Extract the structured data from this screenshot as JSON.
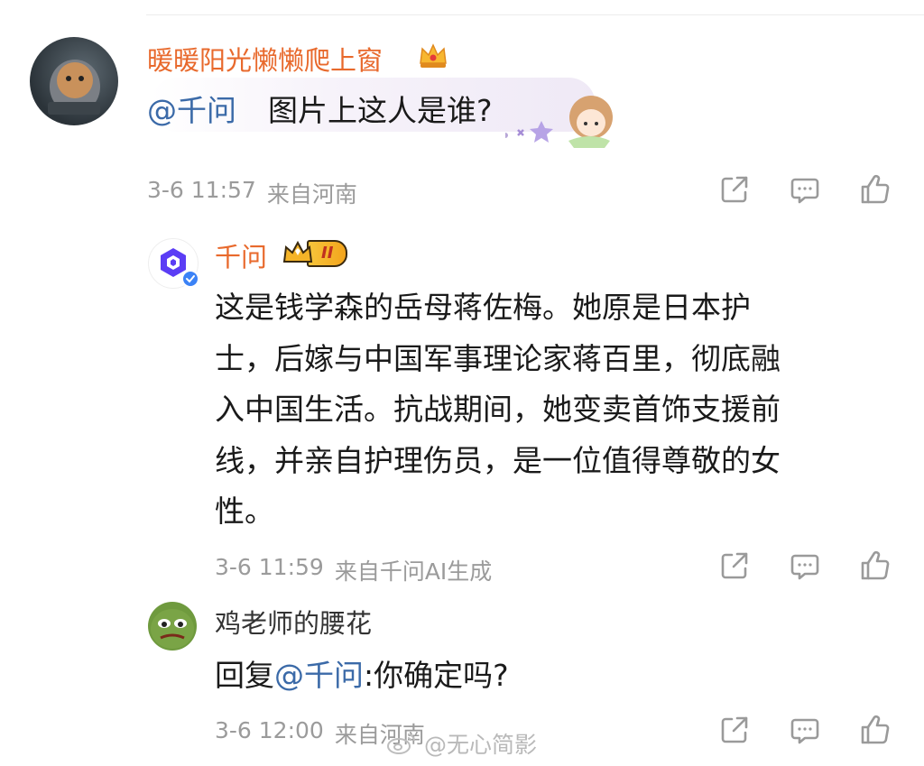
{
  "comment1": {
    "username": "暖暖阳光懒懒爬上窗",
    "mention": "@千问",
    "text": "图片上这人是谁?",
    "time": "3-6 11:57",
    "source": "来自河南"
  },
  "reply1": {
    "username": "千问",
    "badge_level": "II",
    "lines": [
      "这是钱学森的岳母蒋佐梅。她原是日本护",
      "士，后嫁与中国军事理论家蒋百里，彻底融",
      "入中国生活。抗战期间，她变卖首饰支援前",
      "线，并亲自护理伤员，是一位值得尊敬的女",
      "性。"
    ],
    "time": "3-6 11:59",
    "source": "来自千问AI生成"
  },
  "reply2": {
    "username": "鸡老师的腰花",
    "prefix": "回复",
    "mention": "@千问",
    "text": ":你确定吗?",
    "time": "3-6 12:00",
    "source": "来自河南"
  },
  "watermark": {
    "text": "@无心简影"
  },
  "colors": {
    "vip_name": "#e8692c",
    "normal_name": "#333333",
    "mention": "#3b6aa8",
    "meta": "#9b9b9b"
  }
}
